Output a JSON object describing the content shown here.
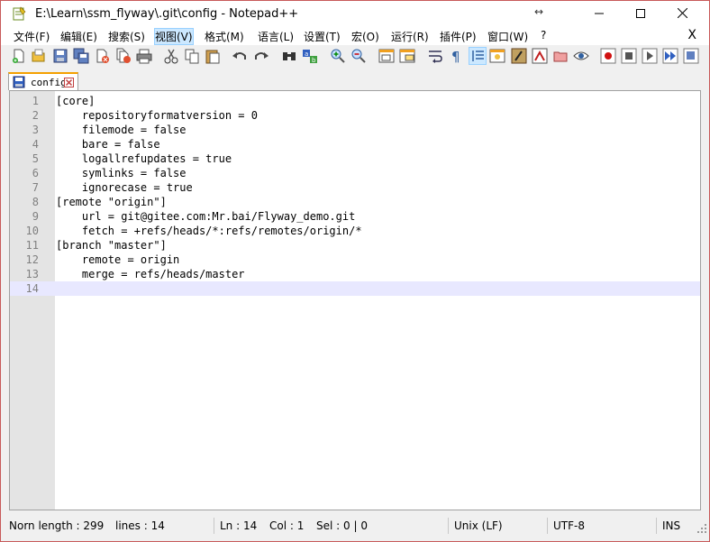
{
  "window": {
    "title": "E:\\Learn\\ssm_flyway\\.git\\config - Notepad++",
    "resize_hint": "↔",
    "buttons": {
      "minimize": "—",
      "maximize": "☐",
      "close": "✕"
    }
  },
  "menu": {
    "items": [
      {
        "label": "文件(F)"
      },
      {
        "label": "编辑(E)"
      },
      {
        "label": "搜索(S)"
      },
      {
        "label": "视图(V)"
      },
      {
        "label": "格式(M)"
      },
      {
        "label": "语言(L)"
      },
      {
        "label": "设置(T)"
      },
      {
        "label": "宏(O)"
      },
      {
        "label": "运行(R)"
      },
      {
        "label": "插件(P)"
      },
      {
        "label": "窗口(W)"
      },
      {
        "label": "?"
      }
    ],
    "close_doc": "X"
  },
  "toolbar": {
    "icons": [
      "new-file-icon",
      "open-file-icon",
      "save-icon",
      "save-all-icon",
      "close-icon",
      "close-all-icon",
      "print-icon",
      "cut-icon",
      "copy-icon",
      "paste-icon",
      "undo-icon",
      "redo-icon",
      "find-icon",
      "replace-icon",
      "zoom-in-icon",
      "zoom-out-icon",
      "sync-vertical-icon",
      "sync-horizontal-icon",
      "word-wrap-icon",
      "show-all-chars-icon",
      "indent-guide-icon",
      "document-map-icon",
      "function-list-icon",
      "folder-workspace-icon",
      "monitoring-icon",
      "eye-icon",
      "record-macro-icon",
      "stop-macro-icon",
      "play-macro-icon",
      "run-macro-multiple-icon",
      "save-macro-icon"
    ]
  },
  "tab": {
    "label": "config"
  },
  "editor": {
    "current_line": 14,
    "lines": [
      {
        "n": "1",
        "text": "[core]"
      },
      {
        "n": "2",
        "text": "    repositoryformatversion = 0"
      },
      {
        "n": "3",
        "text": "    filemode = false"
      },
      {
        "n": "4",
        "text": "    bare = false"
      },
      {
        "n": "5",
        "text": "    logallrefupdates = true"
      },
      {
        "n": "6",
        "text": "    symlinks = false"
      },
      {
        "n": "7",
        "text": "    ignorecase = true"
      },
      {
        "n": "8",
        "text": "[remote \"origin\"]"
      },
      {
        "n": "9",
        "text": "    url = git@gitee.com:Mr.bai/Flyway_demo.git"
      },
      {
        "n": "10",
        "text": "    fetch = +refs/heads/*:refs/remotes/origin/*"
      },
      {
        "n": "11",
        "text": "[branch \"master\"]"
      },
      {
        "n": "12",
        "text": "    remote = origin"
      },
      {
        "n": "13",
        "text": "    merge = refs/heads/master"
      },
      {
        "n": "14",
        "text": ""
      }
    ]
  },
  "status": {
    "length": "Norn length : 299",
    "lines": "lines : 14",
    "ln": "Ln : 14",
    "col": "Col : 1",
    "sel": "Sel : 0 | 0",
    "eol": "Unix (LF)",
    "encoding": "UTF-8",
    "mode": "INS"
  },
  "colors": {
    "accent": "#f4a000",
    "selection": "#cce8ff",
    "current_line": "#e8e8ff"
  }
}
